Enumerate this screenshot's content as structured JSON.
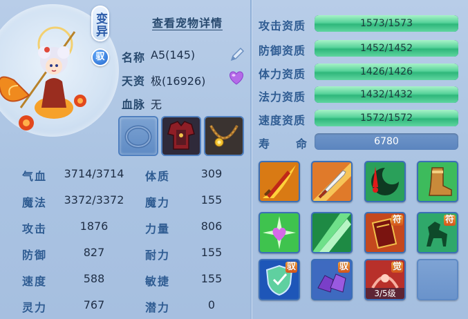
{
  "pet": {
    "change_badge": "变异",
    "tame_badge": "驭",
    "view_detail": "查看宠物详情",
    "name_label": "名称",
    "name_value": "A5(145)",
    "talent_label": "天资",
    "talent_value": "极(16926)",
    "bloodline_label": "血脉",
    "bloodline_value": "无"
  },
  "equipment": [
    {
      "name": "empty-collar-slot"
    },
    {
      "name": "armor"
    },
    {
      "name": "necklace"
    }
  ],
  "stats": [
    {
      "label": "气血",
      "value": "3714/3714",
      "label2": "体质",
      "value2": "309"
    },
    {
      "label": "魔法",
      "value": "3372/3372",
      "label2": "魔力",
      "value2": "155"
    },
    {
      "label": "攻击",
      "value": "1876",
      "label2": "力量",
      "value2": "806"
    },
    {
      "label": "防御",
      "value": "827",
      "label2": "耐力",
      "value2": "155"
    },
    {
      "label": "速度",
      "value": "588",
      "label2": "敏捷",
      "value2": "155"
    },
    {
      "label": "灵力",
      "value": "767",
      "label2": "潜力",
      "value2": "0"
    }
  ],
  "aptitudes": [
    {
      "label": "攻击资质",
      "value": "1573/1573",
      "ratio": 1.0
    },
    {
      "label": "防御资质",
      "value": "1452/1452",
      "ratio": 1.0
    },
    {
      "label": "体力资质",
      "value": "1426/1426",
      "ratio": 1.0
    },
    {
      "label": "法力资质",
      "value": "1432/1432",
      "ratio": 1.0
    },
    {
      "label": "速度资质",
      "value": "1572/1572",
      "ratio": 1.0
    }
  ],
  "lifespan": {
    "label1": "寿",
    "label2": "命",
    "value": "6780"
  },
  "skills": [
    {
      "icon": "flame-sword-icon",
      "tag": "",
      "level": ""
    },
    {
      "icon": "sword-icon",
      "tag": "",
      "level": ""
    },
    {
      "icon": "blood-moon-icon",
      "tag": "",
      "level": ""
    },
    {
      "icon": "boot-icon",
      "tag": "",
      "level": ""
    },
    {
      "icon": "heart-star-icon",
      "tag": "",
      "level": ""
    },
    {
      "icon": "green-slash-icon",
      "tag": "",
      "level": ""
    },
    {
      "icon": "red-tome-icon",
      "tag": "符",
      "level": ""
    },
    {
      "icon": "green-horse-icon",
      "tag": "符",
      "level": ""
    },
    {
      "icon": "shield-icon",
      "tag": "驭",
      "level": ""
    },
    {
      "icon": "purple-rocks-icon",
      "tag": "驭",
      "level": ""
    },
    {
      "icon": "awaken-icon",
      "tag": "觉",
      "level": "3/5级"
    },
    {
      "icon": "empty-slot",
      "tag": "",
      "level": ""
    }
  ]
}
